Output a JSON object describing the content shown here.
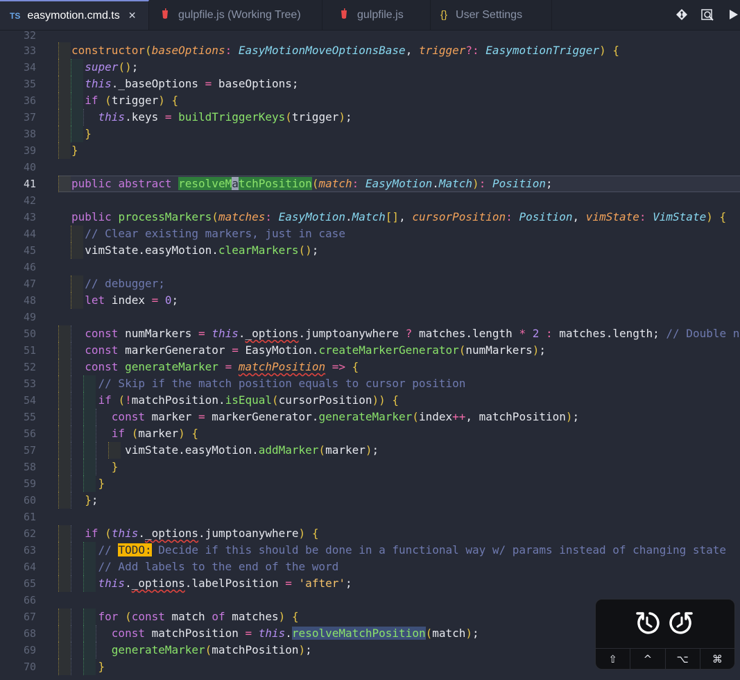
{
  "tabs": [
    {
      "label": "easymotion.cmd.ts",
      "badge": "TS",
      "active": true,
      "close": "✕"
    },
    {
      "label": "gulpfile.js (Working Tree)",
      "icon": "gulp-icon"
    },
    {
      "label": "gulpfile.js",
      "icon": "gulp-icon"
    },
    {
      "label": "User Settings",
      "icon": "braces-icon",
      "glyph": "{}"
    }
  ],
  "toolbar": {
    "icons": [
      "git-compare-icon",
      "open-preview-icon",
      "run-icon"
    ]
  },
  "colors": {
    "background": "#262a36",
    "keyword": "#c678dd",
    "function": "#8be36a",
    "type": "#88d8f0",
    "comment": "#6f7ab0",
    "todo": "#f5b400"
  },
  "lines": [
    {
      "n": "32",
      "text": ""
    },
    {
      "n": "33",
      "text": "constructor(baseOptions: EasyMotionMoveOptionsBase, trigger?: EasymotionTrigger) {"
    },
    {
      "n": "34",
      "text": "  super();"
    },
    {
      "n": "35",
      "text": "  this._baseOptions = baseOptions;"
    },
    {
      "n": "36",
      "text": "  if (trigger) {"
    },
    {
      "n": "37",
      "text": "    this.keys = buildTriggerKeys(trigger);"
    },
    {
      "n": "38",
      "text": "  }"
    },
    {
      "n": "39",
      "text": "}"
    },
    {
      "n": "40",
      "text": ""
    },
    {
      "n": "41",
      "text": "public abstract resolveMatchPosition(match: EasyMotion.Match): Position;"
    },
    {
      "n": "42",
      "text": ""
    },
    {
      "n": "43",
      "text": "public processMarkers(matches: EasyMotion.Match[], cursorPosition: Position, vimState: VimState) {"
    },
    {
      "n": "44",
      "text": "  // Clear existing markers, just in case"
    },
    {
      "n": "45",
      "text": "  vimState.easyMotion.clearMarkers();"
    },
    {
      "n": "46",
      "text": ""
    },
    {
      "n": "47",
      "text": "  // debugger;"
    },
    {
      "n": "48",
      "text": "  let index = 0;"
    },
    {
      "n": "49",
      "text": ""
    },
    {
      "n": "50",
      "text": "  const numMarkers = this._options.jumptoanywhere ? matches.length * 2 : matches.length; // Double numb"
    },
    {
      "n": "51",
      "text": "  const markerGenerator = EasyMotion.createMarkerGenerator(numMarkers);"
    },
    {
      "n": "52",
      "text": "  const generateMarker = matchPosition => {"
    },
    {
      "n": "53",
      "text": "    // Skip if the match position equals to cursor position"
    },
    {
      "n": "54",
      "text": "    if (!matchPosition.isEqual(cursorPosition)) {"
    },
    {
      "n": "55",
      "text": "      const marker = markerGenerator.generateMarker(index++, matchPosition);"
    },
    {
      "n": "56",
      "text": "      if (marker) {"
    },
    {
      "n": "57",
      "text": "        vimState.easyMotion.addMarker(marker);"
    },
    {
      "n": "58",
      "text": "      }"
    },
    {
      "n": "59",
      "text": "    }"
    },
    {
      "n": "60",
      "text": "  };"
    },
    {
      "n": "61",
      "text": ""
    },
    {
      "n": "62",
      "text": "  if (this._options.jumptoanywhere) {"
    },
    {
      "n": "63",
      "text": "    // TODO: Decide if this should be done in a functional way w/ params instead of changing state"
    },
    {
      "n": "64",
      "text": "    // Add labels to the end of the word"
    },
    {
      "n": "65",
      "text": "    this._options.labelPosition = 'after';"
    },
    {
      "n": "66",
      "text": ""
    },
    {
      "n": "67",
      "text": "    for (const match of matches) {"
    },
    {
      "n": "68",
      "text": "      const matchPosition = this.resolveMatchPosition(match);"
    },
    {
      "n": "69",
      "text": "      generateMarker(matchPosition);"
    },
    {
      "n": "70",
      "text": "    }"
    }
  ],
  "current_line": "41",
  "touchbar": {
    "buttons": [
      "undo-icon",
      "redo-icon"
    ],
    "keys": [
      "⇧",
      "^",
      "⌥",
      "⌘"
    ]
  }
}
